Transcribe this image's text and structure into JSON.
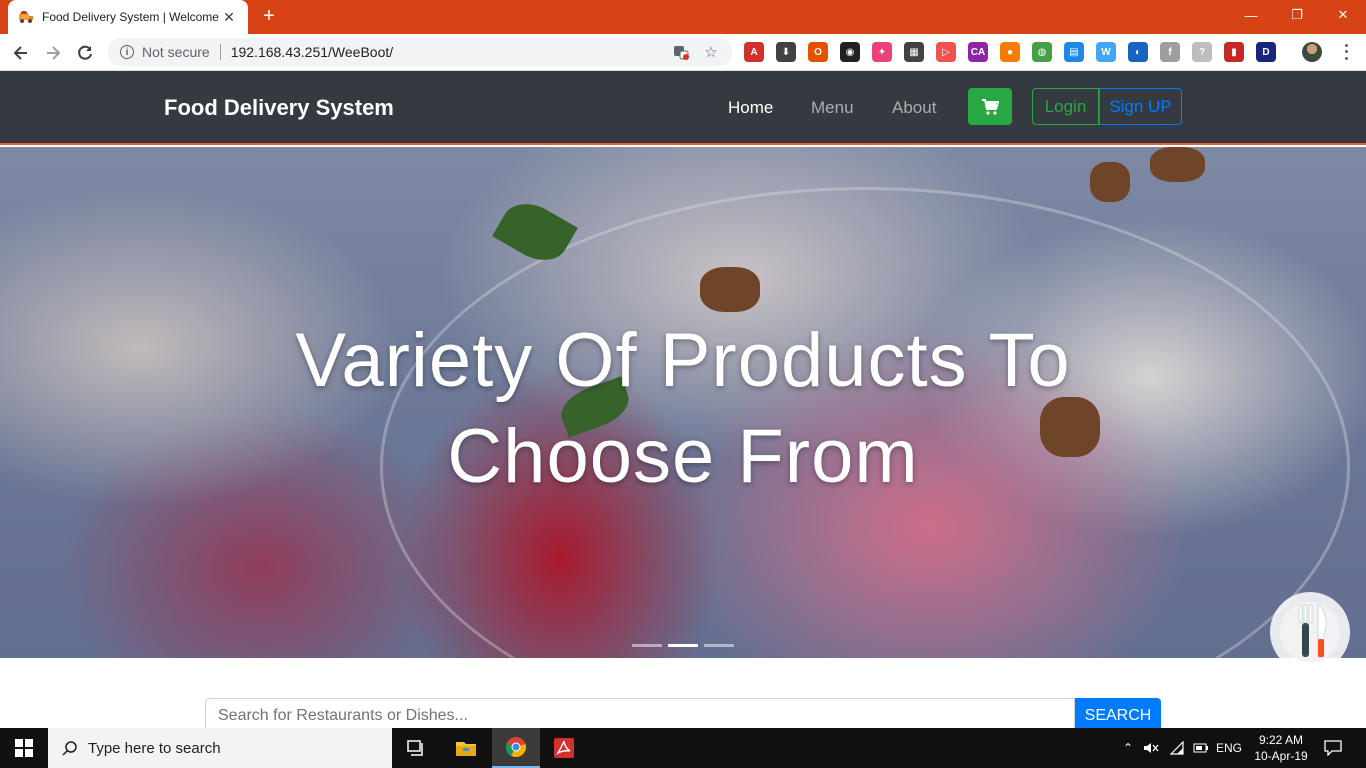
{
  "browser": {
    "tab_title": "Food Delivery System | Welcome",
    "tab_close": "✕",
    "new_tab": "+",
    "window_controls": [
      "—",
      "❐",
      "✕"
    ],
    "not_secure": "Not secure",
    "url": "192.168.43.251/WeeBoot/",
    "extensions": [
      {
        "name": "acrobat-extension-icon",
        "color": "#d32f2f",
        "glyph": "A"
      },
      {
        "name": "download-extension-icon",
        "color": "#424242",
        "glyph": "⬇"
      },
      {
        "name": "office-extension-icon",
        "color": "#e65100",
        "glyph": "O"
      },
      {
        "name": "color-picker-extension-icon",
        "color": "#212121",
        "glyph": "◉"
      },
      {
        "name": "unicorn-extension-icon",
        "color": "#ec407a",
        "glyph": "✦"
      },
      {
        "name": "qr-code-extension-icon",
        "color": "#424242",
        "glyph": "▦"
      },
      {
        "name": "cast-extension-icon",
        "color": "#ef5350",
        "glyph": "▷"
      },
      {
        "name": "ca-extension-icon",
        "color": "#8e24aa",
        "glyph": "CA"
      },
      {
        "name": "orange-circle-extension-icon",
        "color": "#f57c00",
        "glyph": "●"
      },
      {
        "name": "globe-extension-icon",
        "color": "#43a047",
        "glyph": "◍"
      },
      {
        "name": "docs-extension-icon",
        "color": "#1e88e5",
        "glyph": "▤"
      },
      {
        "name": "wordpress-extension-icon",
        "color": "#42a5f5",
        "glyph": "W"
      },
      {
        "name": "earth-extension-icon",
        "color": "#1565c0",
        "glyph": "◐"
      },
      {
        "name": "font-extension-icon",
        "color": "#9e9e9e",
        "glyph": "f"
      },
      {
        "name": "help-extension-icon",
        "color": "#bdbdbd",
        "glyph": "?"
      },
      {
        "name": "book-extension-icon",
        "color": "#c62828",
        "glyph": "▮"
      },
      {
        "name": "d-extension-icon",
        "color": "#1a237e",
        "glyph": "D"
      }
    ]
  },
  "site": {
    "brand": "Food Delivery System",
    "nav": {
      "home": "Home",
      "menu": "Menu",
      "about": "About"
    },
    "login": "Login",
    "signup": "Sign UP",
    "hero_heading": "Variety Of Products To Choose From",
    "carousel": {
      "count": 3,
      "active_index": 1
    },
    "search": {
      "placeholder": "Search for Restaurants or Dishes...",
      "button": "SEARCH"
    }
  },
  "taskbar": {
    "search_placeholder": "Type here to search",
    "tray_language": "ENG",
    "time": "9:22 AM",
    "date": "10-Apr-19"
  },
  "colors": {
    "tabstrip": "#d84315",
    "navbar": "#343a40",
    "success": "#28a745",
    "primary": "#007bff"
  }
}
